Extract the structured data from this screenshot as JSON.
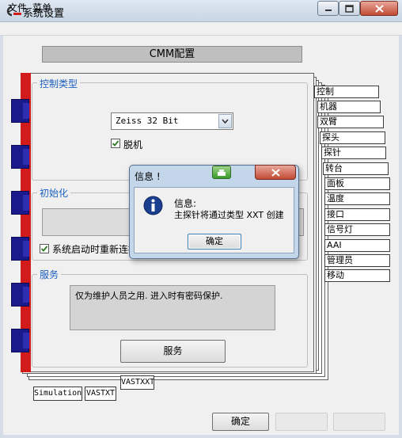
{
  "window": {
    "title": "系统设置",
    "icon": "app-logo-icon"
  },
  "menu": {
    "file": "文件",
    "edit": "菜单"
  },
  "header": {
    "title": "CMM配置"
  },
  "control_type": {
    "title": "控制类型",
    "selected": "Zeiss 32 Bit",
    "offline_label": "脱机",
    "offline_checked": true
  },
  "init": {
    "title": "初始化",
    "reconnect_label": "系统启动时重新连接",
    "reconnect_checked": true
  },
  "service": {
    "title": "服务",
    "note": "仅为维护人员之用. 进入时有密码保护.",
    "button": "服务"
  },
  "side_tabs": [
    "控制",
    "机器",
    "双臂",
    "探头",
    "探针",
    "转台",
    "面板",
    "温度",
    "接口",
    "信号灯",
    "AAI",
    "管理员",
    "移动"
  ],
  "bottom_tabs": {
    "vastxxt": "VASTXXT",
    "simulation": "Simulation",
    "vastxt": "VASTXT"
  },
  "footer": {
    "ok": "确定"
  },
  "dialog": {
    "title": "信息 !",
    "line1": "信息:",
    "line2": "主探针将通过类型 XXT 创建",
    "ok": "确定"
  },
  "colors": {
    "accent_red": "#d21b1b",
    "binder_blue": "#1a1a8c",
    "group_title_blue": "#1d5fbf"
  }
}
